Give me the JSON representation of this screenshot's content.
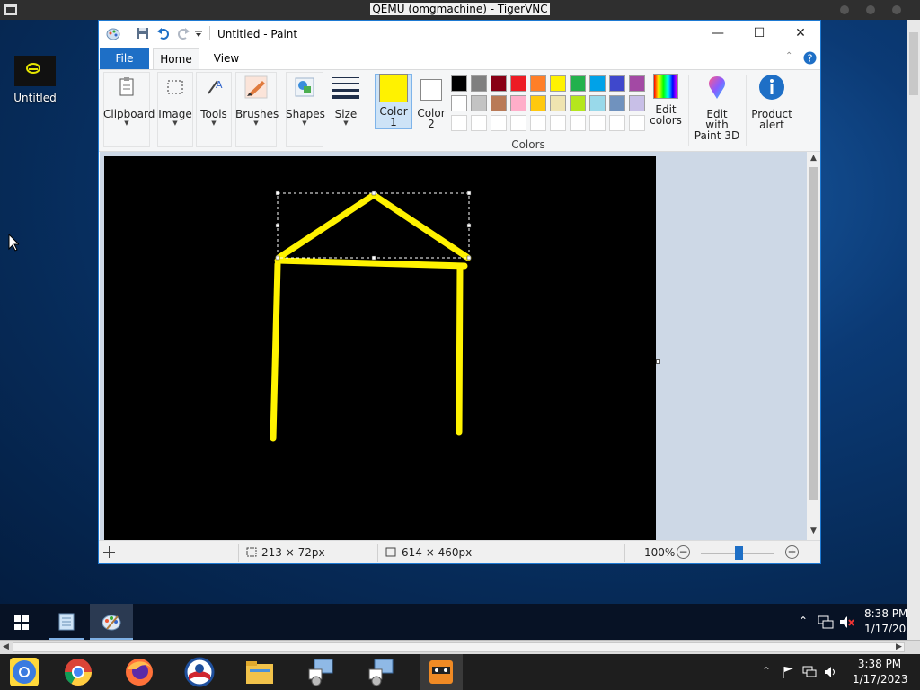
{
  "vnc": {
    "title": "QEMU (omgmachine) - TigerVNC"
  },
  "desktop": {
    "icon_label": "Untitled"
  },
  "paint": {
    "title": "Untitled - Paint",
    "tabs": {
      "file": "File",
      "home": "Home",
      "view": "View"
    },
    "ribbon": {
      "clipboard": "Clipboard",
      "image": "Image",
      "tools": "Tools",
      "brushes": "Brushes",
      "shapes": "Shapes",
      "size": "Size",
      "color1": [
        "Color",
        "1"
      ],
      "color2": [
        "Color",
        "2"
      ],
      "colors_group": "Colors",
      "edit_colors": [
        "Edit",
        "colors"
      ],
      "paint3d": [
        "Edit with",
        "Paint 3D"
      ],
      "product_alert": [
        "Product",
        "alert"
      ]
    },
    "palette": {
      "row1": [
        "#000000",
        "#7f7f7f",
        "#880015",
        "#ed1c24",
        "#ff7f27",
        "#fff200",
        "#22b14c",
        "#00a2e8",
        "#3f48cc",
        "#a349a4"
      ],
      "row2": [
        "#ffffff",
        "#c3c3c3",
        "#b97a57",
        "#ffaec9",
        "#ffc90e",
        "#efe4b0",
        "#b5e61d",
        "#99d9ea",
        "#7092be",
        "#c8bfe7"
      ],
      "row3_empty": 10
    },
    "active_color1": "#fff200",
    "active_color2": "#ffffff",
    "status": {
      "selection_size": "213 × 72px",
      "image_size": "614 × 460px",
      "zoom": "100%"
    }
  },
  "taskbar": {
    "time": "8:38 PM",
    "date": "1/17/2023"
  },
  "host_taskbar": {
    "time": "3:38 PM",
    "date": "1/17/2023"
  }
}
